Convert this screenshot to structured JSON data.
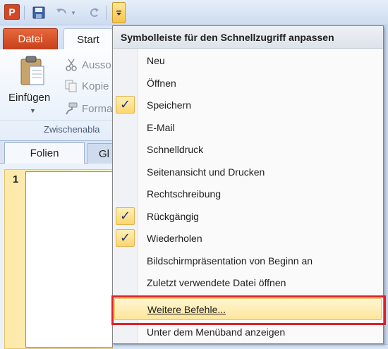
{
  "app_icon_letter": "P",
  "tabs": {
    "datei": "Datei",
    "start": "Start"
  },
  "clipboard": {
    "paste_label": "Einfügen",
    "cut_label": "Ausso",
    "copy_label": "Kopie",
    "format_label": "Forma",
    "group_label": "Zwischenabla"
  },
  "pane": {
    "tab_folien": "Folien",
    "tab_gl": "Gl",
    "slide_number": "1"
  },
  "menu": {
    "header": "Symbolleiste für den Schnellzugriff anpassen",
    "items": [
      {
        "label": "Neu",
        "checked": false
      },
      {
        "label": "Öffnen",
        "checked": false
      },
      {
        "label": "Speichern",
        "checked": true
      },
      {
        "label": "E-Mail",
        "checked": false
      },
      {
        "label": "Schnelldruck",
        "checked": false
      },
      {
        "label": "Seitenansicht und Drucken",
        "checked": false
      },
      {
        "label": "Rechtschreibung",
        "checked": false
      },
      {
        "label": "Rückgängig",
        "checked": true
      },
      {
        "label": "Wiederholen",
        "checked": true
      },
      {
        "label": "Bildschirmpräsentation von Beginn an",
        "checked": false
      },
      {
        "label": "Zuletzt verwendete Datei öffnen",
        "checked": false
      }
    ],
    "more_commands": "Weitere Befehle...",
    "below_ribbon": "Unter dem Menüband anzeigen"
  },
  "colors": {
    "highlight_box": "#e0202a",
    "datei_tab": "#d24726",
    "check": "#1c3b7a"
  }
}
